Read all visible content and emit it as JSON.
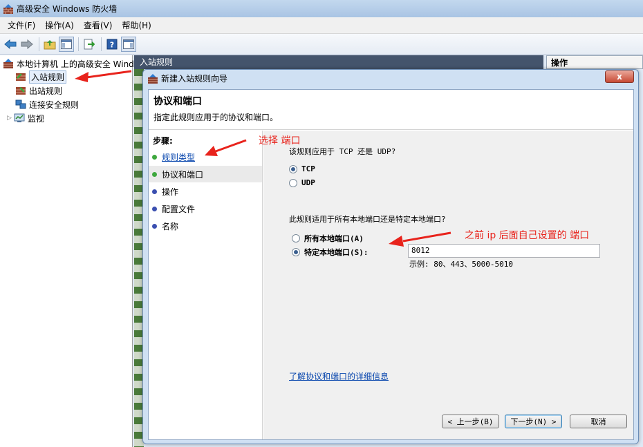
{
  "window": {
    "title": "高级安全 Windows 防火墙"
  },
  "menu": [
    "文件(F)",
    "操作(A)",
    "查看(V)",
    "帮助(H)"
  ],
  "tree": {
    "root": "本地计算机 上的高级安全 Windows",
    "items": [
      "入站规则",
      "出站规则",
      "连接安全规则",
      "监视"
    ]
  },
  "middle": {
    "header": "入站规则"
  },
  "actions": {
    "header": "操作"
  },
  "dialog": {
    "title": "新建入站规则向导",
    "close_label": "x",
    "heading": "协议和端口",
    "subheading": "指定此规则应用于的协议和端口。",
    "steps_title": "步骤:",
    "steps": [
      "规则类型",
      "协议和端口",
      "操作",
      "配置文件",
      "名称"
    ],
    "question1": "该规则应用于 TCP 还是 UDP?",
    "protocol_options": [
      "TCP",
      "UDP"
    ],
    "selected_protocol": "TCP",
    "question2": "此规则适用于所有本地端口还是特定本地端口?",
    "port_options": [
      "所有本地端口(A)",
      "特定本地端口(S):"
    ],
    "selected_port_option": "特定本地端口(S):",
    "port_value": "8012",
    "example": "示例: 80、443、5000-5010",
    "learn_more": "了解协议和端口的详细信息",
    "buttons": {
      "back": "< 上一步(B)",
      "next": "下一步(N) >",
      "cancel": "取消"
    }
  },
  "annotations": {
    "select_port": "选择 端口",
    "port_note": "之前 ip 后面自己设置的 端口"
  },
  "colors": {
    "annotation": "#e8231c",
    "header_dark": "#44546c",
    "link": "#0645ad"
  }
}
